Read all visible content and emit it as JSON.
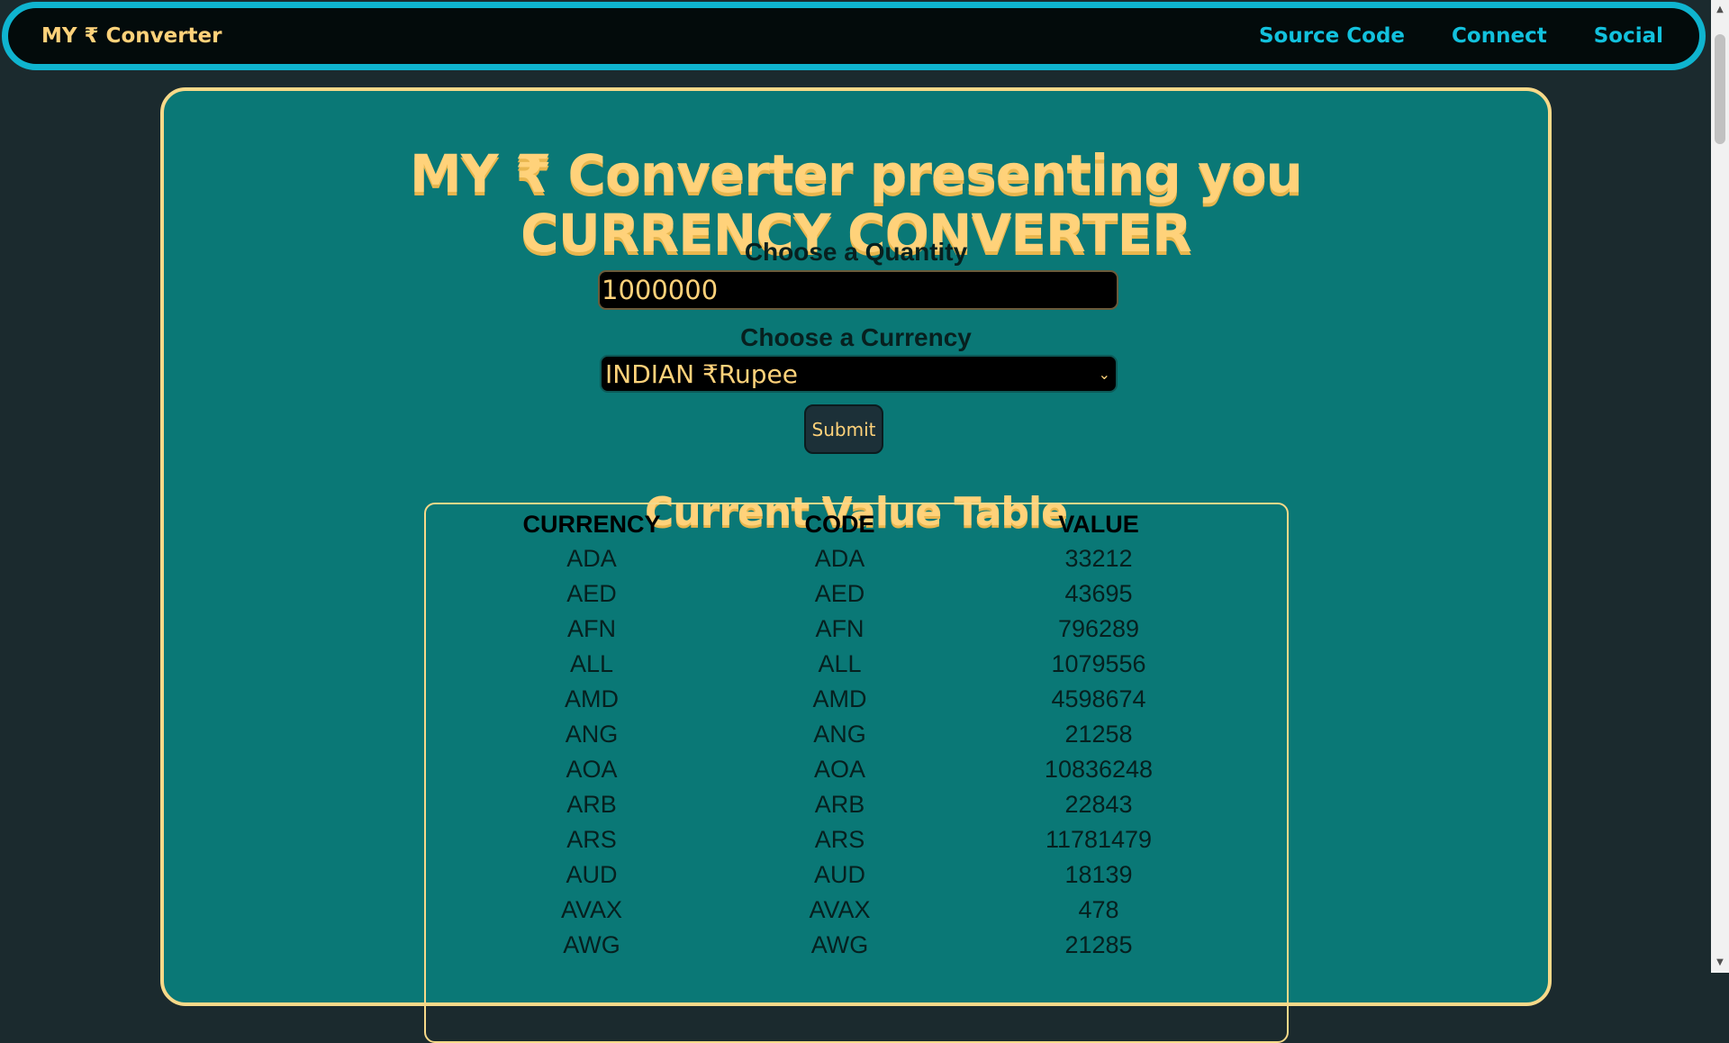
{
  "nav": {
    "brand": "MY ₹ Converter",
    "links": [
      "Source Code",
      "Connect",
      "Social"
    ]
  },
  "hero": {
    "line1": "MY ₹ Converter presenting you",
    "line2": "CURRENCY CONVERTER"
  },
  "form": {
    "quantity_label": "Choose a Quantity",
    "quantity_value": "1000000",
    "currency_label": "Choose a Currency",
    "currency_selected": "INDIAN ₹Rupee",
    "submit_label": "Submit"
  },
  "table": {
    "title": "Current Value Table",
    "headers": [
      "CURRENCY",
      "CODE",
      "VALUE"
    ],
    "rows": [
      [
        "ADA",
        "ADA",
        "33212"
      ],
      [
        "AED",
        "AED",
        "43695"
      ],
      [
        "AFN",
        "AFN",
        "796289"
      ],
      [
        "ALL",
        "ALL",
        "1079556"
      ],
      [
        "AMD",
        "AMD",
        "4598674"
      ],
      [
        "ANG",
        "ANG",
        "21258"
      ],
      [
        "AOA",
        "AOA",
        "10836248"
      ],
      [
        "ARB",
        "ARB",
        "22843"
      ],
      [
        "ARS",
        "ARS",
        "11781479"
      ],
      [
        "AUD",
        "AUD",
        "18139"
      ],
      [
        "AVAX",
        "AVAX",
        "478"
      ],
      [
        "AWG",
        "AWG",
        "21285"
      ]
    ]
  },
  "colors": {
    "accent_cyan": "#0fb4cf",
    "accent_yellow": "#ffd27a",
    "card_teal": "#0a7876"
  }
}
